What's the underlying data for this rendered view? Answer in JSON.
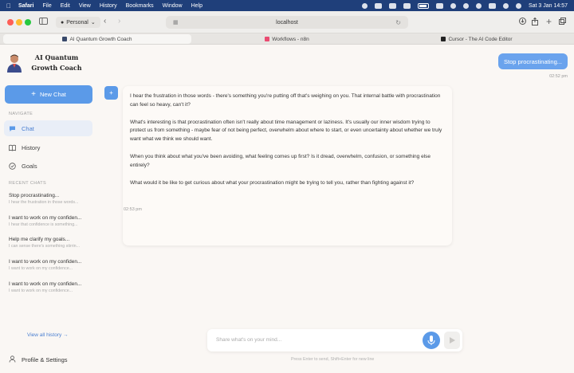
{
  "menubar": {
    "app_name": "Safari",
    "items": [
      "File",
      "Edit",
      "View",
      "History",
      "Bookmarks",
      "Window",
      "Help"
    ],
    "clock": "Sat 3 Jan  14:57"
  },
  "toolbar": {
    "profile_label": "Personal",
    "url": "localhost"
  },
  "tabs": [
    {
      "title": "AI Quantum Growth Coach",
      "icon_color": "#3a4a6b"
    },
    {
      "title": "Workflows - n8n",
      "icon_color": "#ea4b71"
    },
    {
      "title": "Cursor - The AI Code Editor",
      "icon_color": "#222222"
    }
  ],
  "sidebar": {
    "brand_line1": "AI Quantum",
    "brand_line2": "Growth Coach",
    "new_chat_label": "New Chat",
    "navigate_label": "NAVIGATE",
    "nav": [
      {
        "label": "Chat",
        "icon": "chat-bubble-icon"
      },
      {
        "label": "History",
        "icon": "book-icon"
      },
      {
        "label": "Goals",
        "icon": "target-icon"
      }
    ],
    "recent_label": "RECENT CHATS",
    "recent": [
      {
        "title": "Stop procrastinating...",
        "snippet": "I hear the frustration in those words..."
      },
      {
        "title": "I want to work on my confiden...",
        "snippet": "I hear that confidence is something..."
      },
      {
        "title": "Help me clarify my goals...",
        "snippet": "I can sense there's something stirrin..."
      },
      {
        "title": "I want to work on my confiden...",
        "snippet": "I want to work on my confidence..."
      },
      {
        "title": "I want to work on my confiden...",
        "snippet": "I want to work on my confidence..."
      }
    ],
    "view_all_label": "View all history →",
    "profile_settings_label": "Profile & Settings"
  },
  "chat": {
    "user_message": "Stop procrastinating...",
    "user_time": "02:52 pm",
    "ai_paragraphs": [
      "I hear the frustration in those words - there's something you're putting off that's weighing on you. That internal battle with procrastination can feel so heavy, can't it?",
      "What's interesting is that procrastination often isn't really about time management or laziness. It's usually our inner wisdom trying to protect us from something - maybe fear of not being perfect, overwhelm about where to start, or even uncertainty about whether we truly want what we think we should want.",
      "When you think about what you've been avoiding, what feeling comes up first? Is it dread, overwhelm, confusion, or something else entirely?",
      "What would it be like to get curious about what your procrastination might be trying to tell you, rather than fighting against it?"
    ],
    "ai_time": "02:53 pm",
    "input_placeholder": "Share what's on your mind...",
    "hint": "Press Enter to send, Shift+Enter for new line"
  },
  "colors": {
    "accent": "#5b9ae8",
    "menubar": "#1f3f7a"
  }
}
